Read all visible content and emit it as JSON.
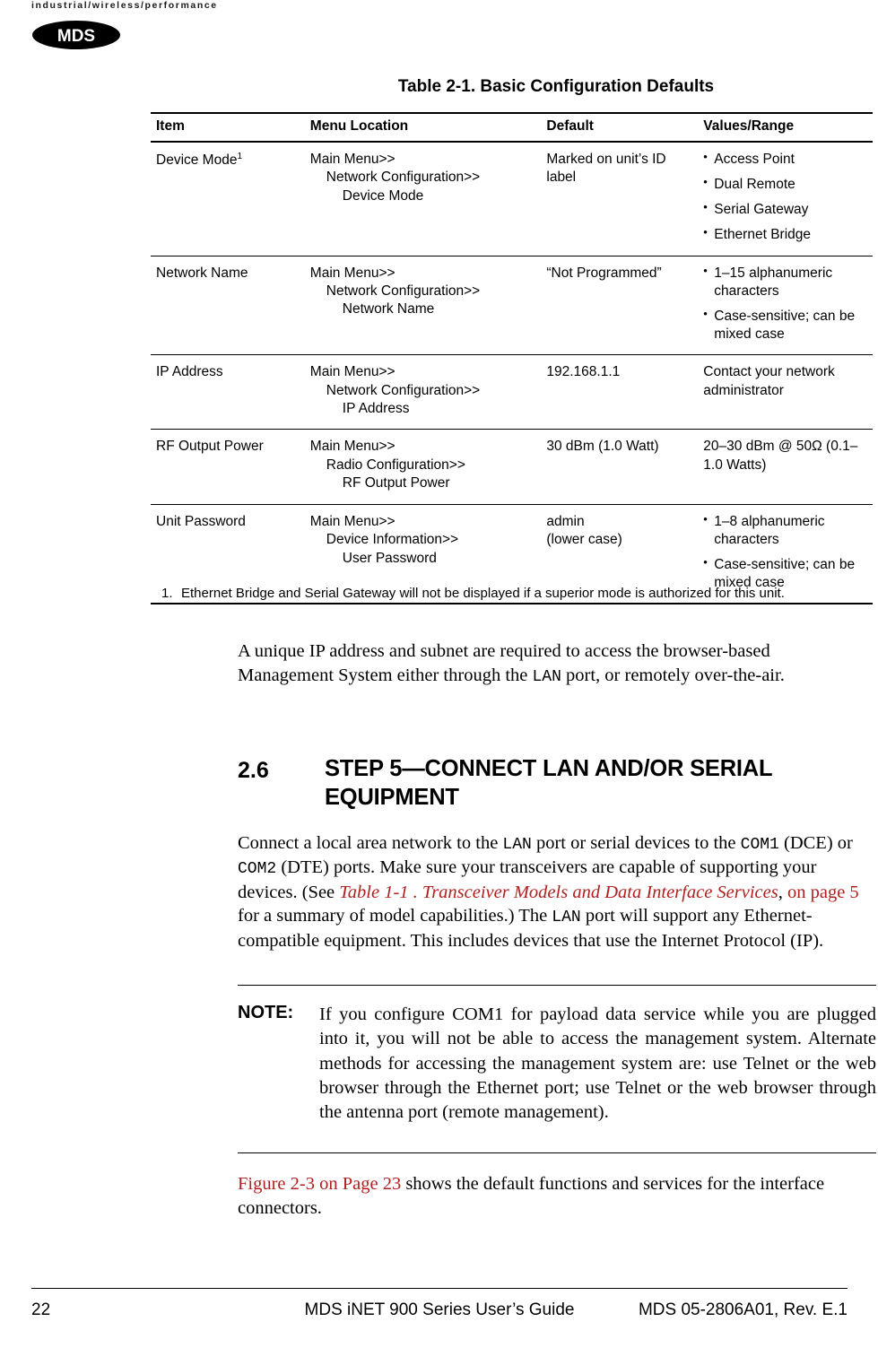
{
  "header": {
    "tagline": "industrial/wireless/performance",
    "logo_text": "MDS"
  },
  "table": {
    "title": "Table 2-1. Basic Configuration Defaults",
    "headers": [
      "Item",
      "Menu Location",
      "Default",
      "Values/Range"
    ],
    "rows": [
      {
        "item": "Device Mode",
        "item_footnote": "1",
        "menu_l1": "Main Menu>>",
        "menu_l2": "Network Configuration>>",
        "menu_l3": "Device Mode",
        "default": "Marked on unit’s ID label",
        "values": [
          "Access Point",
          "Dual Remote",
          "Serial Gateway",
          "Ethernet Bridge"
        ]
      },
      {
        "item": "Network Name",
        "item_footnote": "",
        "menu_l1": "Main Menu>>",
        "menu_l2": "Network Configuration>>",
        "menu_l3": "Network Name",
        "default": "“Not Programmed”",
        "values": [
          "1–15 alphanumeric characters",
          "Case-sensitive; can be mixed case"
        ]
      },
      {
        "item": "IP Address",
        "item_footnote": "",
        "menu_l1": "Main Menu>>",
        "menu_l2": "Network Configuration>>",
        "menu_l3": "IP Address",
        "default": "192.168.1.1",
        "values_plain": "Contact your network administrator"
      },
      {
        "item": "RF Output Power",
        "item_footnote": "",
        "menu_l1": "Main Menu>>",
        "menu_l2": "Radio Configuration>>",
        "menu_l3": "RF Output Power",
        "default": "30 dBm (1.0 Watt)",
        "values_plain": "20–30 dBm @ 50Ω (0.1–1.0 Watts)"
      },
      {
        "item": "Unit Password",
        "item_footnote": "",
        "menu_l1": "Main Menu>>",
        "menu_l2": "Device Information>>",
        "menu_l3": "User Password",
        "default": "admin\n(lower case)",
        "values": [
          "1–8 alphanumeric characters",
          "Case-sensitive; can be mixed case"
        ]
      }
    ],
    "footnote_number": "1.",
    "footnote_text": "Ethernet Bridge and Serial Gateway will not be displayed if a superior mode is authorized for this unit."
  },
  "body": {
    "para1_a": "A unique IP address and subnet are required to access the browser-based Management System either through the ",
    "para1_mono": "LAN",
    "para1_b": " port, or remotely over-the-air.",
    "section_number": "2.6",
    "section_title": "STEP 5—CONNECT LAN AND/OR SERIAL EQUIPMENT",
    "para2_1": "Connect a local area network to the ",
    "para2_mono1": "LAN",
    "para2_2": " port or serial devices to the ",
    "para2_mono2": "COM1",
    "para2_3": " (DCE) or ",
    "para2_mono3": "COM2",
    "para2_4": " (DTE) ports. Make sure your transceivers are capable of supporting your devices. (See ",
    "para2_link_italic": "Table 1-1 . Transceiver Models and Data Interface Services",
    "para2_5": ", ",
    "para2_link2": "on page 5",
    "para2_6": " for a summary of model capabilities.) The ",
    "para2_mono4": "LAN",
    "para2_7": " port will support any Ethernet-compatible equipment. This includes devices that use the Internet Protocol (IP).",
    "note_label": "NOTE:",
    "note_text": "If you configure COM1 for payload data service while you are plugged into it, you will not be able to access the management system. Alternate methods for accessing the management system are: use Telnet or the web browser through the Ethernet port; use Telnet or the web browser through the antenna port (remote management).",
    "para3_link": "Figure 2-3 on Page 23",
    "para3_rest": " shows the default functions and services for the interface connectors."
  },
  "footer": {
    "page_number": "22",
    "title": "MDS iNET 900 Series User’s Guide",
    "doc_id": "MDS 05-2806A01, Rev. E.1"
  },
  "colors": {
    "link": "#b02020",
    "text": "#000000"
  }
}
